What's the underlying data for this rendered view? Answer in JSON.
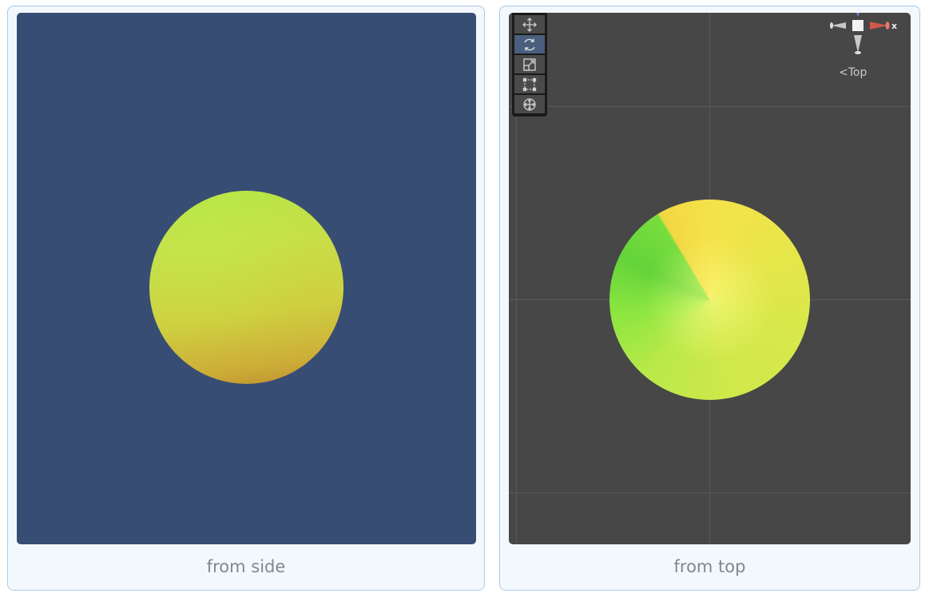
{
  "panels": [
    {
      "caption": "from side",
      "view": "side"
    },
    {
      "caption": "from top",
      "view": "top"
    }
  ],
  "scene_view": {
    "tools": [
      "move-icon",
      "rotate-icon",
      "scale-icon",
      "rect-icon",
      "transform-icon"
    ],
    "active_tool": "rotate-icon",
    "gizmo_axis_label": "x",
    "view_label": "Top"
  },
  "colors": {
    "side_background": "#384d74",
    "top_background": "#474747",
    "card_border": "#a8cbe6",
    "card_fill": "#f3f8fd"
  }
}
